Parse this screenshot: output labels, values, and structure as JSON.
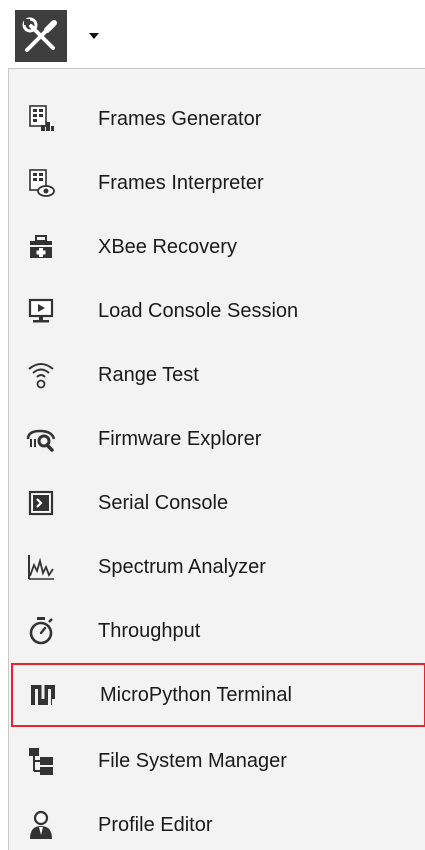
{
  "toolbar": {
    "tools_icon": "wrench-screwdriver-icon",
    "dropdown_icon": "caret-down-icon"
  },
  "menu": {
    "items": [
      {
        "label": "Frames Generator",
        "icon": "frames-generator-icon"
      },
      {
        "label": "Frames Interpreter",
        "icon": "frames-interpreter-icon"
      },
      {
        "label": "XBee Recovery",
        "icon": "first-aid-kit-icon"
      },
      {
        "label": "Load Console Session",
        "icon": "monitor-play-icon"
      },
      {
        "label": "Range Test",
        "icon": "wireless-signal-icon"
      },
      {
        "label": "Firmware Explorer",
        "icon": "firmware-search-icon"
      },
      {
        "label": "Serial Console",
        "icon": "terminal-prompt-icon"
      },
      {
        "label": "Spectrum Analyzer",
        "icon": "spectrum-wave-icon"
      },
      {
        "label": "Throughput",
        "icon": "stopwatch-icon"
      },
      {
        "label": "MicroPython Terminal",
        "icon": "micropython-icon",
        "highlighted": true
      },
      {
        "label": "File System Manager",
        "icon": "file-tree-icon"
      },
      {
        "label": "Profile Editor",
        "icon": "user-profile-icon"
      }
    ]
  },
  "colors": {
    "highlight_border": "#e8232f",
    "menu_background": "#f3f3f3",
    "icon_dark": "#3e3e3e"
  }
}
